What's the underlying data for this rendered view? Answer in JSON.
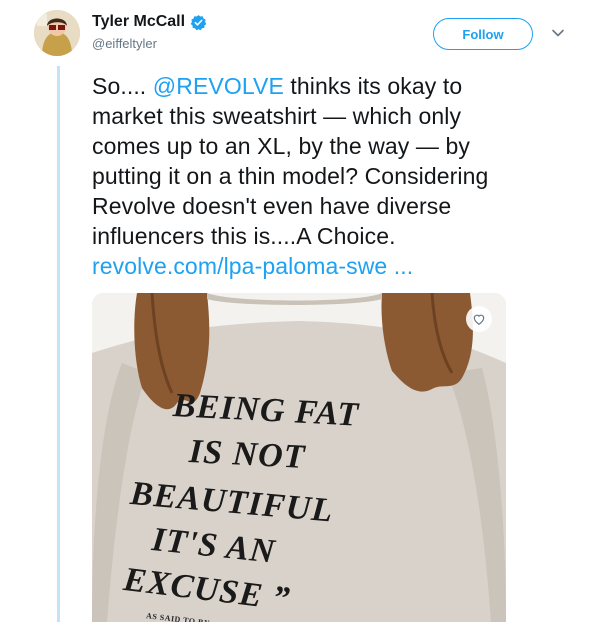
{
  "user": {
    "display_name": "Tyler McCall",
    "handle": "@eiffeltyler",
    "verified": true
  },
  "actions": {
    "follow_label": "Follow"
  },
  "tweet": {
    "lines": [
      {
        "before": "So.... ",
        "mention": "@REVOLVE",
        "after": " thinks its okay to"
      },
      {
        "text": "market this sweatshirt — which only"
      },
      {
        "text": "comes up to an XL, by the way — by"
      },
      {
        "text": "putting it on a thin model? Considering"
      },
      {
        "text": "Revolve doesn't even have diverse"
      },
      {
        "text": "influencers this is....A Choice."
      }
    ],
    "link": "revolve.com/lpa-paloma-swe ..."
  },
  "media": {
    "shirt_lines": [
      "BEING FAT",
      "IS NOT",
      "BEAUTIFUL",
      "IT'S AN",
      "EXCUSE ”"
    ],
    "small_text": "AS SAID TO BY"
  },
  "colors": {
    "accent": "#1da1f2",
    "thread_line": "#c4e4f5",
    "text": "#14171a",
    "muted": "#657786"
  },
  "icons": {
    "verified": "verified-badge-icon",
    "menu": "chevron-down-icon",
    "like": "heart-icon"
  }
}
